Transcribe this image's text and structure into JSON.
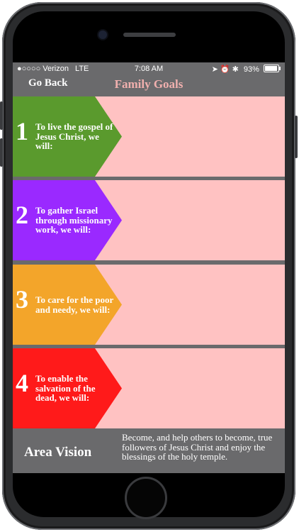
{
  "status_bar": {
    "carrier": "●○○○○ Verizon",
    "network": "LTE",
    "time": "7:08 AM",
    "indicators": "➤ ⏰ ✱",
    "battery_percent": "93%",
    "battery_level": 0.93
  },
  "nav": {
    "back_label": "Go Back",
    "title": "Family Goals"
  },
  "goals": [
    {
      "number": "1",
      "text": "To live the gospel of Jesus Christ, we will:",
      "color": "#5a9a2d"
    },
    {
      "number": "2",
      "text": "To gather Israel through missionary work, we will:",
      "color": "#9a29ff"
    },
    {
      "number": "3",
      "text": "To care for the poor and needy, we will:",
      "color": "#f3a52a"
    },
    {
      "number": "4",
      "text": "To enable the salvation of the dead, we will:",
      "color": "#ff1a1a"
    }
  ],
  "row_background": "#ffc2c2",
  "area_vision": {
    "title": "Area Vision",
    "text": "Become, and help others to become, true followers of Jesus Christ and enjoy the blessings of the holy temple."
  },
  "icons": [
    "camera-icon",
    "speaker-grille",
    "location-arrow-icon",
    "alarm-icon",
    "bluetooth-icon",
    "battery-icon",
    "home-button"
  ]
}
